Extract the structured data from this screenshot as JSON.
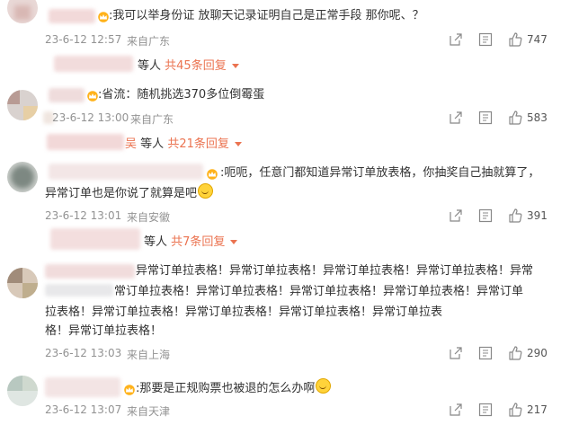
{
  "comments": [
    {
      "text": ":我可以举身份证 放聊天记录证明自己是正常手段 那你呢、？",
      "date": "23-6-12 12:57",
      "location": "来自广东",
      "likes": "747",
      "replies": {
        "suffix": "等人",
        "more": "共45条回复"
      }
    },
    {
      "text": ":省流：随机挑选370多位倒霉蛋",
      "date": "23-6-12 13:00",
      "location": "来自广东",
      "likes": "583",
      "replies": {
        "name_tail": "吴",
        "suffix": "等人",
        "more": "共21条回复"
      }
    },
    {
      "text_line1": ":呃呃，任意门都知道异常订单放表格，你抽奖自己抽就算了，",
      "text_line2": "异常订单也是你说了就算是吧",
      "date": "23-6-12 13:01",
      "location": "来自安徽",
      "likes": "391",
      "replies": {
        "suffix": "等人",
        "more": "共7条回复"
      }
    },
    {
      "lines": [
        "异常订单拉表格！异常订单拉表格！异常订单拉表格！异常订单拉表格！异常",
        "常订单拉表格！异常订单拉表格！异常订单拉表格！异常订单拉表格！异常订单",
        "拉表格！异常订单拉表格！异常订单拉表格！异常订单拉表格！异常订单拉表",
        "格！异常订单拉表格！"
      ],
      "date": "23-6-12 13:03",
      "location": "来自上海",
      "likes": "290"
    },
    {
      "text": ":那要是正规购票也被退的怎么办啊",
      "date": "23-6-12 13:07",
      "location": "来自天津",
      "likes": "217"
    }
  ],
  "icons": [
    "share-icon",
    "comment-icon",
    "like-icon",
    "crown-badge-icon",
    "emoji-icon",
    "dropdown-arrow-icon"
  ],
  "colors": {
    "accent": "#eb7350",
    "meta": "#939393",
    "text": "#333333"
  }
}
